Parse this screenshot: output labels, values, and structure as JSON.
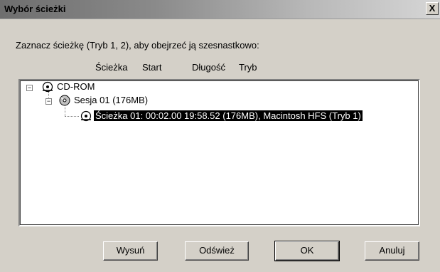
{
  "window": {
    "title": "Wybór ścieżki",
    "close_glyph": "X"
  },
  "instruction": "Zaznacz ścieżkę (Tryb 1, 2), aby obejrzeć ją szesnastkowo:",
  "columns": {
    "track": "Ścieżka",
    "start": "Start",
    "length": "Długość",
    "mode": "Tryb"
  },
  "tree": {
    "root": {
      "label": "CD-ROM",
      "icon": "cd-drive-icon",
      "expanded": true
    },
    "session": {
      "label": "Sesja 01  (176MB)",
      "icon": "cd-disc-icon",
      "expanded": true
    },
    "track": {
      "label": "Ścieżka 01: 00:02.00  19:58.52  (176MB),  Macintosh HFS (Tryb 1)",
      "icon": "cd-track-icon",
      "selected": true
    }
  },
  "buttons": {
    "eject": "Wysuń",
    "refresh": "Odśwież",
    "ok": "OK",
    "cancel": "Anuluj"
  },
  "colors": {
    "face": "#d4d0c8",
    "selection_bg": "#000000",
    "selection_text": "#ffffff"
  }
}
